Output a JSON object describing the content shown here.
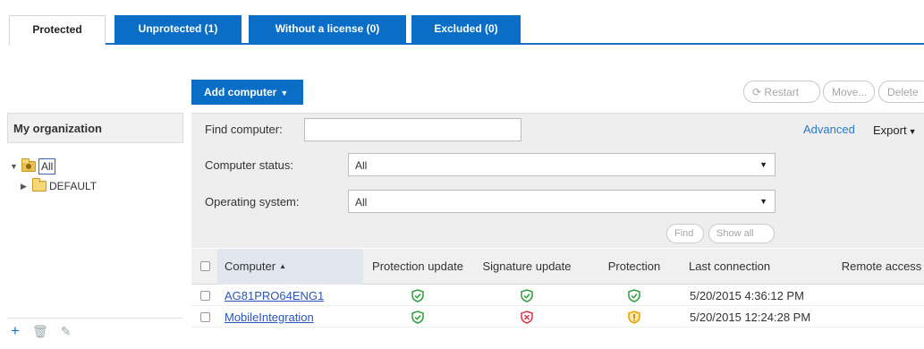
{
  "tabs": [
    {
      "label": "Protected",
      "active": true
    },
    {
      "label": "Unprotected (1)",
      "active": false
    },
    {
      "label": "Without a license (0)",
      "active": false
    },
    {
      "label": "Excluded (0)",
      "active": false
    }
  ],
  "sidebar": {
    "title": "My organization",
    "tree": [
      {
        "label": "All",
        "expanded": true,
        "selected": true
      },
      {
        "label": "DEFAULT",
        "expanded": false,
        "selected": false
      }
    ]
  },
  "toolbar": {
    "add_computer": "Add computer",
    "restart": "Restart",
    "move": "Move...",
    "delete": "Delete"
  },
  "filters": {
    "find_label": "Find computer:",
    "find_value": "",
    "advanced": "Advanced",
    "export": "Export",
    "status_label": "Computer status:",
    "status_value": "All",
    "os_label": "Operating system:",
    "os_value": "All",
    "find_button": "Find",
    "show_all_button": "Show all"
  },
  "table": {
    "columns": [
      "Computer",
      "Protection update",
      "Signature update",
      "Protection",
      "Last connection",
      "Remote access"
    ],
    "rows": [
      {
        "computer": "AG81PRO64ENG1",
        "protection_update": "ok",
        "signature_update": "ok",
        "protection": "ok",
        "last_connection": "5/20/2015 4:36:12 PM",
        "remote_access": ""
      },
      {
        "computer": "MobileIntegration",
        "protection_update": "ok",
        "signature_update": "error",
        "protection": "warning",
        "last_connection": "5/20/2015 12:24:28 PM",
        "remote_access": ""
      }
    ]
  },
  "colors": {
    "accent": "#0a6ec7",
    "ok": "#2e9d3b",
    "error": "#d8344a",
    "warning": "#e0a400"
  },
  "icons": {
    "ok": "shield-check-icon",
    "error": "shield-x-icon",
    "warning": "shield-exclamation-icon"
  }
}
